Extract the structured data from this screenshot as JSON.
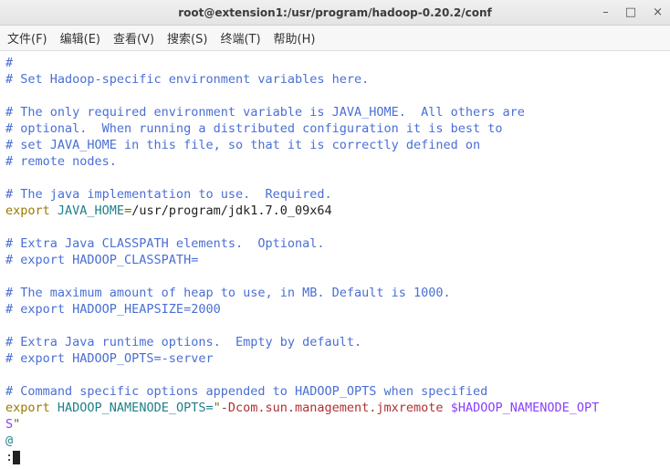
{
  "window": {
    "title": "root@extension1:/usr/program/hadoop-0.20.2/conf",
    "btn_min": "–",
    "btn_max": "□",
    "btn_close": "×"
  },
  "menu": {
    "file": "文件(F)",
    "edit": "编辑(E)",
    "view": "查看(V)",
    "search": "搜索(S)",
    "terminal": "终端(T)",
    "help": "帮助(H)"
  },
  "content": {
    "l1_hash": "#",
    "l2": "# Set Hadoop-specific environment variables here.",
    "l4": "# The only required environment variable is JAVA_HOME.  All others are",
    "l5": "# optional.  When running a distributed configuration it is best to",
    "l6": "# set JAVA_HOME in this file, so that it is correctly defined on",
    "l7": "# remote nodes.",
    "l9": "# The java implementation to use.  Required.",
    "l10_export": "export",
    "l10_var": " JAVA_HOME",
    "l10_eq": "=",
    "l10_val": "/usr/program/jdk1.7.0_09x64",
    "l12": "# Extra Java CLASSPATH elements.  Optional.",
    "l13": "# export HADOOP_CLASSPATH=",
    "l15": "# The maximum amount of heap to use, in MB. Default is 1000.",
    "l16": "# export HADOOP_HEAPSIZE=2000",
    "l18": "# Extra Java runtime options.  Empty by default.",
    "l19": "# export HADOOP_OPTS=-server",
    "l21": "# Command specific options appended to HADOOP_OPTS when specified",
    "l22_export": "export",
    "l22_var": " HADOOP_NAMENODE_OPTS=",
    "l22_q": "\"",
    "l22_str": "-Dcom.sun.management.jmxremote ",
    "l22_spec": "$HADOOP_NAMENODE_OPT",
    "l23_spec": "S",
    "l23_q": "\"",
    "l24_at": "@",
    "prompt": ":"
  }
}
